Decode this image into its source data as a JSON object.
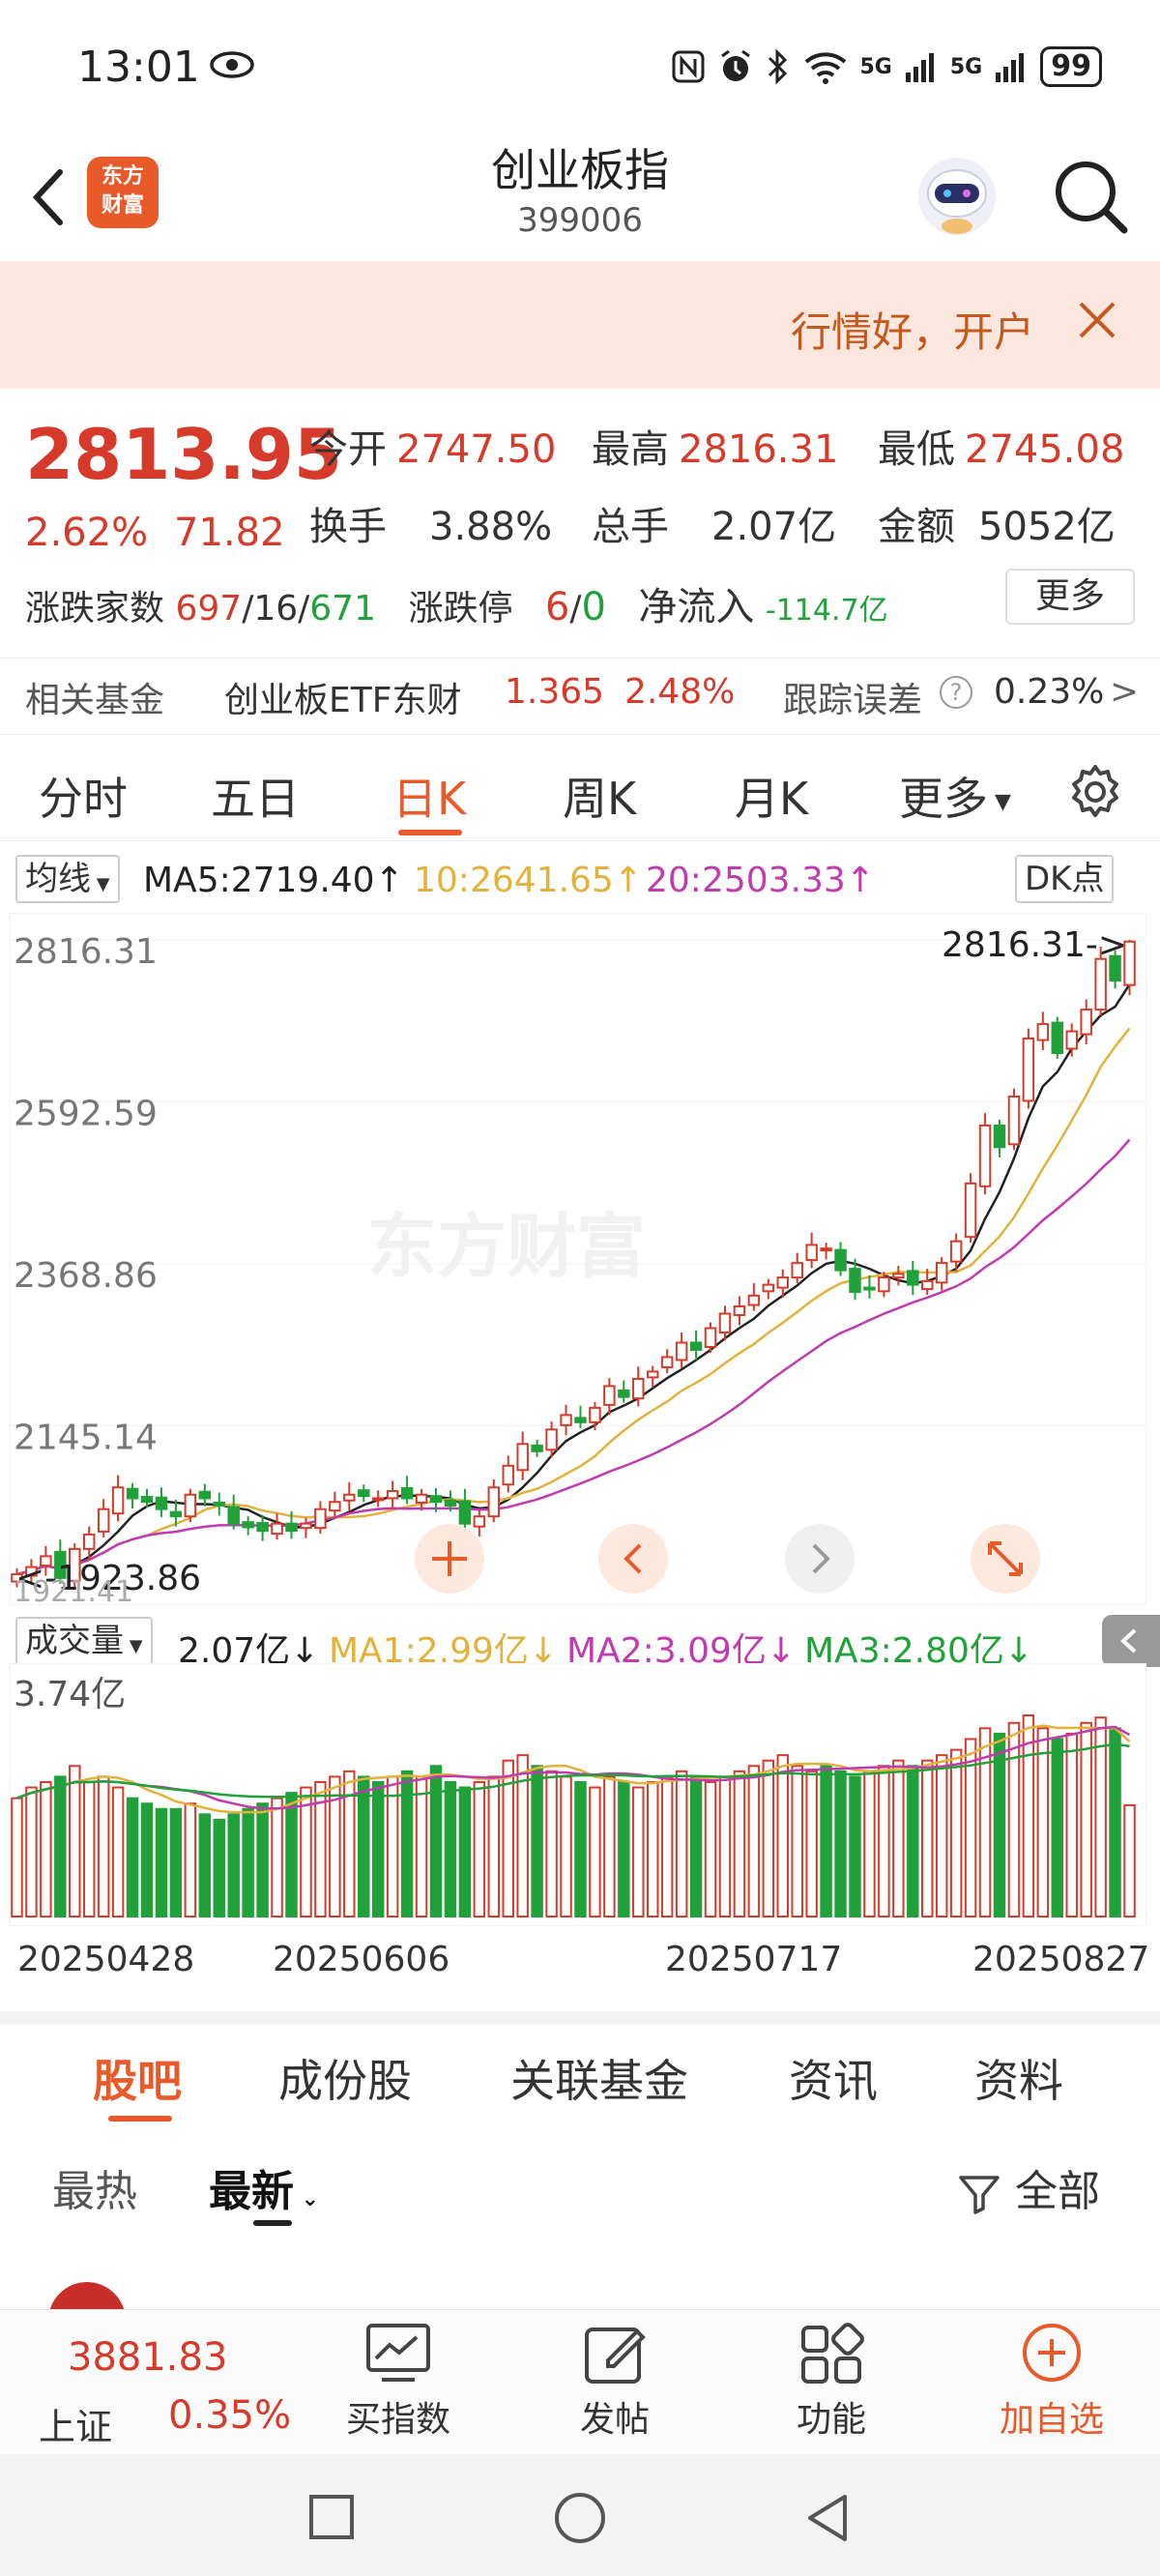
{
  "status_bar": {
    "time": "13:01",
    "network_1": "5G",
    "network_2": "5G",
    "battery": "99",
    "icons": [
      "eye-icon",
      "nfc-icon",
      "alarm-icon",
      "bluetooth-icon",
      "wifi-icon",
      "signal-icon",
      "signal-icon",
      "battery-icon"
    ]
  },
  "header": {
    "title": "创业板指",
    "code": "399006",
    "logo_text_1": "东方",
    "logo_text_2": "财富"
  },
  "banner": {
    "text": "行情好，开户"
  },
  "quote": {
    "price": "2813.95",
    "change_pct": "2.62%",
    "change": "71.82",
    "open_label": "今开",
    "open": "2747.50",
    "high_label": "最高",
    "high": "2816.31",
    "low_label": "最低",
    "low": "2745.08",
    "turnover_label": "换手",
    "turnover": "3.88%",
    "volume_label": "总手",
    "volume": "2.07亿",
    "amount_label": "金额",
    "amount": "5052亿",
    "breadth_label": "涨跌家数",
    "up": "697",
    "flat": "16",
    "down": "671",
    "limit_label": "涨跌停",
    "limit_up": "6",
    "limit_down": "0",
    "inflow_label": "净流入",
    "inflow": "-114.7亿",
    "more": "更多"
  },
  "fund": {
    "label": "相关基金",
    "name": "创业板ETF东财",
    "price": "1.365",
    "pct": "2.48%",
    "error_label": "跟踪误差",
    "error": "0.23%",
    "arrow": ">"
  },
  "chart_tabs": [
    "分时",
    "五日",
    "日K",
    "周K",
    "月K",
    "更多"
  ],
  "ma": {
    "selector": "均线",
    "ma5": "MA5:2719.40↑",
    "ma10": "10:2641.65↑",
    "ma20": "20:2503.33↑",
    "dk": "DK点"
  },
  "volume": {
    "selector": "成交量",
    "value": "2.07亿↓",
    "ma1": "MA1:2.99亿↓",
    "ma2": "MA2:3.09亿↓",
    "ma3": "MA3:2.80亿↓",
    "ymax_label": "3.74亿"
  },
  "chart_data": {
    "type": "candlestick",
    "y_ticks": [
      "2816.31",
      "2592.59",
      "2368.86",
      "2145.14"
    ],
    "ylim": [
      1921.41,
      2816.31
    ],
    "high_marker": "2816.31->",
    "low_marker": "<-1923.86",
    "low_bound": "1921.41",
    "dates": [
      "20250428",
      "20250606",
      "20250717",
      "20250827"
    ],
    "watermark": "东方财富",
    "close": [
      1940,
      1950,
      1965,
      1935,
      1975,
      1995,
      2030,
      2060,
      2045,
      2040,
      2030,
      2020,
      2050,
      2045,
      2035,
      2010,
      2005,
      2000,
      2010,
      2000,
      2010,
      2030,
      2040,
      2050,
      2048,
      2045,
      2055,
      2045,
      2050,
      2040,
      2035,
      2010,
      2020,
      2060,
      2090,
      2120,
      2110,
      2140,
      2160,
      2150,
      2170,
      2200,
      2185,
      2210,
      2220,
      2240,
      2260,
      2250,
      2280,
      2300,
      2310,
      2325,
      2340,
      2350,
      2370,
      2395,
      2390,
      2360,
      2330,
      2335,
      2350,
      2355,
      2340,
      2345,
      2370,
      2400,
      2480,
      2560,
      2530,
      2600,
      2680,
      2700,
      2660,
      2690,
      2720,
      2790,
      2760,
      2813.95
    ],
    "volume": [
      2.2,
      2.4,
      2.5,
      2.6,
      2.8,
      2.5,
      2.6,
      2.4,
      2.2,
      2.1,
      2.0,
      2.0,
      2.1,
      1.9,
      1.8,
      1.9,
      2.0,
      2.1,
      2.2,
      2.3,
      2.4,
      2.5,
      2.6,
      2.7,
      2.6,
      2.5,
      2.6,
      2.7,
      2.6,
      2.8,
      2.5,
      2.4,
      2.5,
      2.6,
      2.9,
      3.0,
      2.8,
      2.7,
      2.6,
      2.5,
      2.4,
      2.6,
      2.5,
      2.4,
      2.5,
      2.6,
      2.7,
      2.6,
      2.5,
      2.6,
      2.7,
      2.8,
      2.9,
      3.0,
      2.8,
      2.7,
      2.8,
      2.7,
      2.6,
      2.7,
      2.8,
      2.9,
      2.8,
      2.9,
      3.0,
      3.1,
      3.3,
      3.5,
      3.4,
      3.6,
      3.74,
      3.5,
      3.3,
      3.4,
      3.6,
      3.7,
      3.5,
      2.07
    ]
  },
  "sub_tabs": [
    "股吧",
    "成份股",
    "关联基金",
    "资讯",
    "资料"
  ],
  "filter": {
    "hot": "最热",
    "newest": "最新",
    "all": "全部"
  },
  "bottom_nav": {
    "index_value": "3881.83",
    "index_name": "上证",
    "index_pct": "0.35%",
    "buy_index": "买指数",
    "post": "发帖",
    "function": "功能",
    "add_watch": "加自选"
  },
  "colors": {
    "accent": "#e95a2b",
    "up": "#d63a2a",
    "down": "#21a13a",
    "ma5": "#222222",
    "ma10": "#e3b23c",
    "ma20": "#c03bb0"
  }
}
